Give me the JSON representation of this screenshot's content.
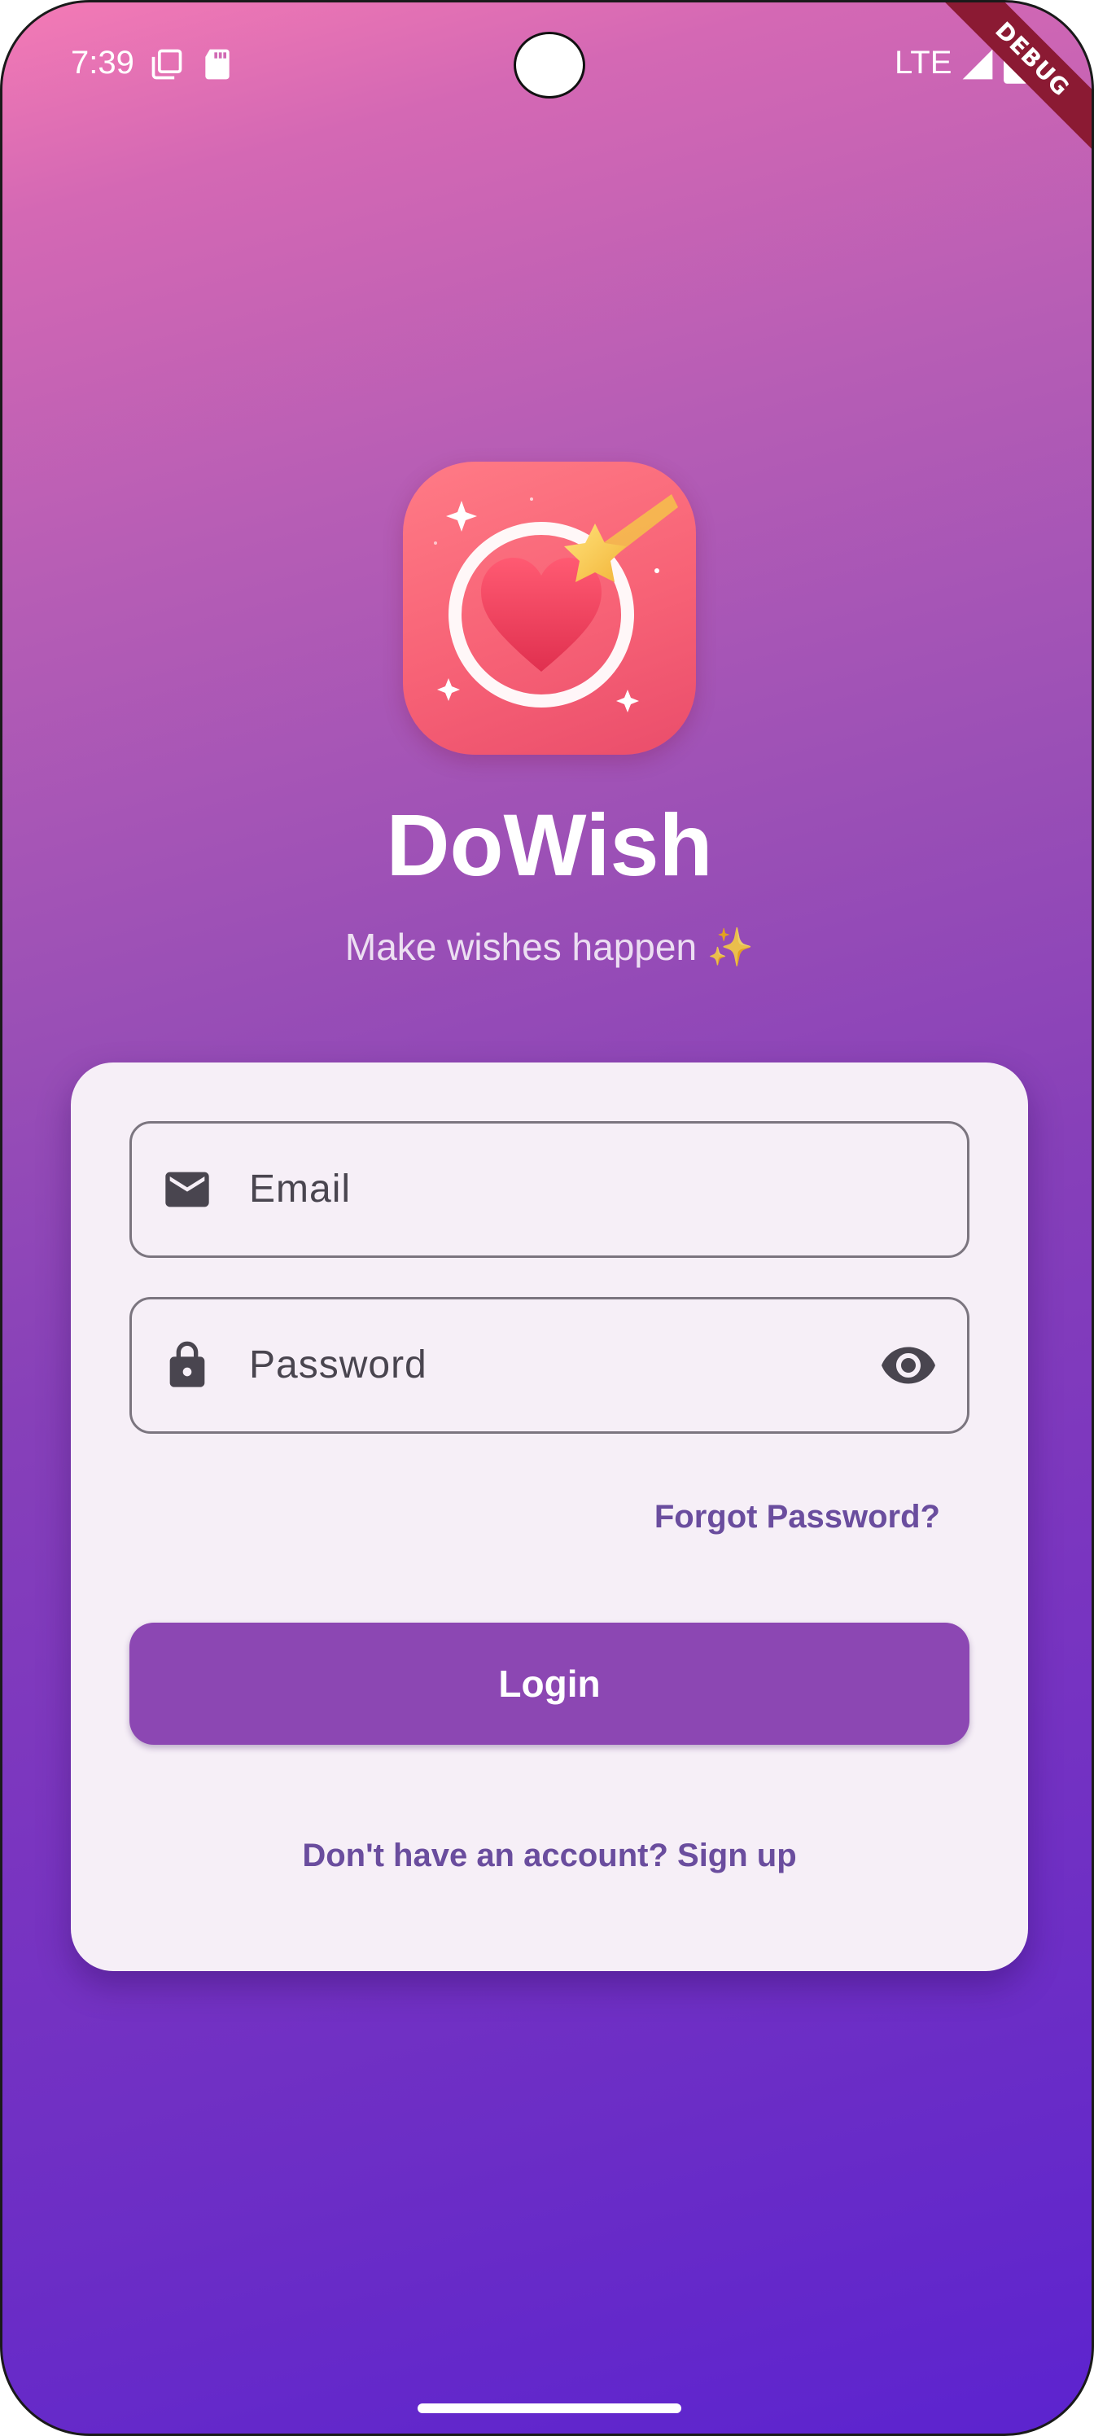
{
  "status_bar": {
    "time": "7:39",
    "network": "LTE",
    "icons": [
      "screen-copy-icon",
      "sd-card-icon",
      "signal-icon",
      "battery-icon"
    ]
  },
  "debug_banner": "DEBUG",
  "app": {
    "title": "DoWish",
    "subtitle": "Make wishes happen ✨",
    "logo": "dowish-logo-heart-shooting-star"
  },
  "login_form": {
    "email_placeholder": "Email",
    "password_placeholder": "Password",
    "forgot_password": "Forgot Password?",
    "login_button": "Login",
    "signup_prompt": "Don't have an account? Sign up"
  },
  "colors": {
    "gradient_top": "#f47bb5",
    "gradient_bottom": "#5c23cf",
    "primary": "#8c47b3",
    "link": "#6a4d9e",
    "card": "#f6eff7"
  }
}
